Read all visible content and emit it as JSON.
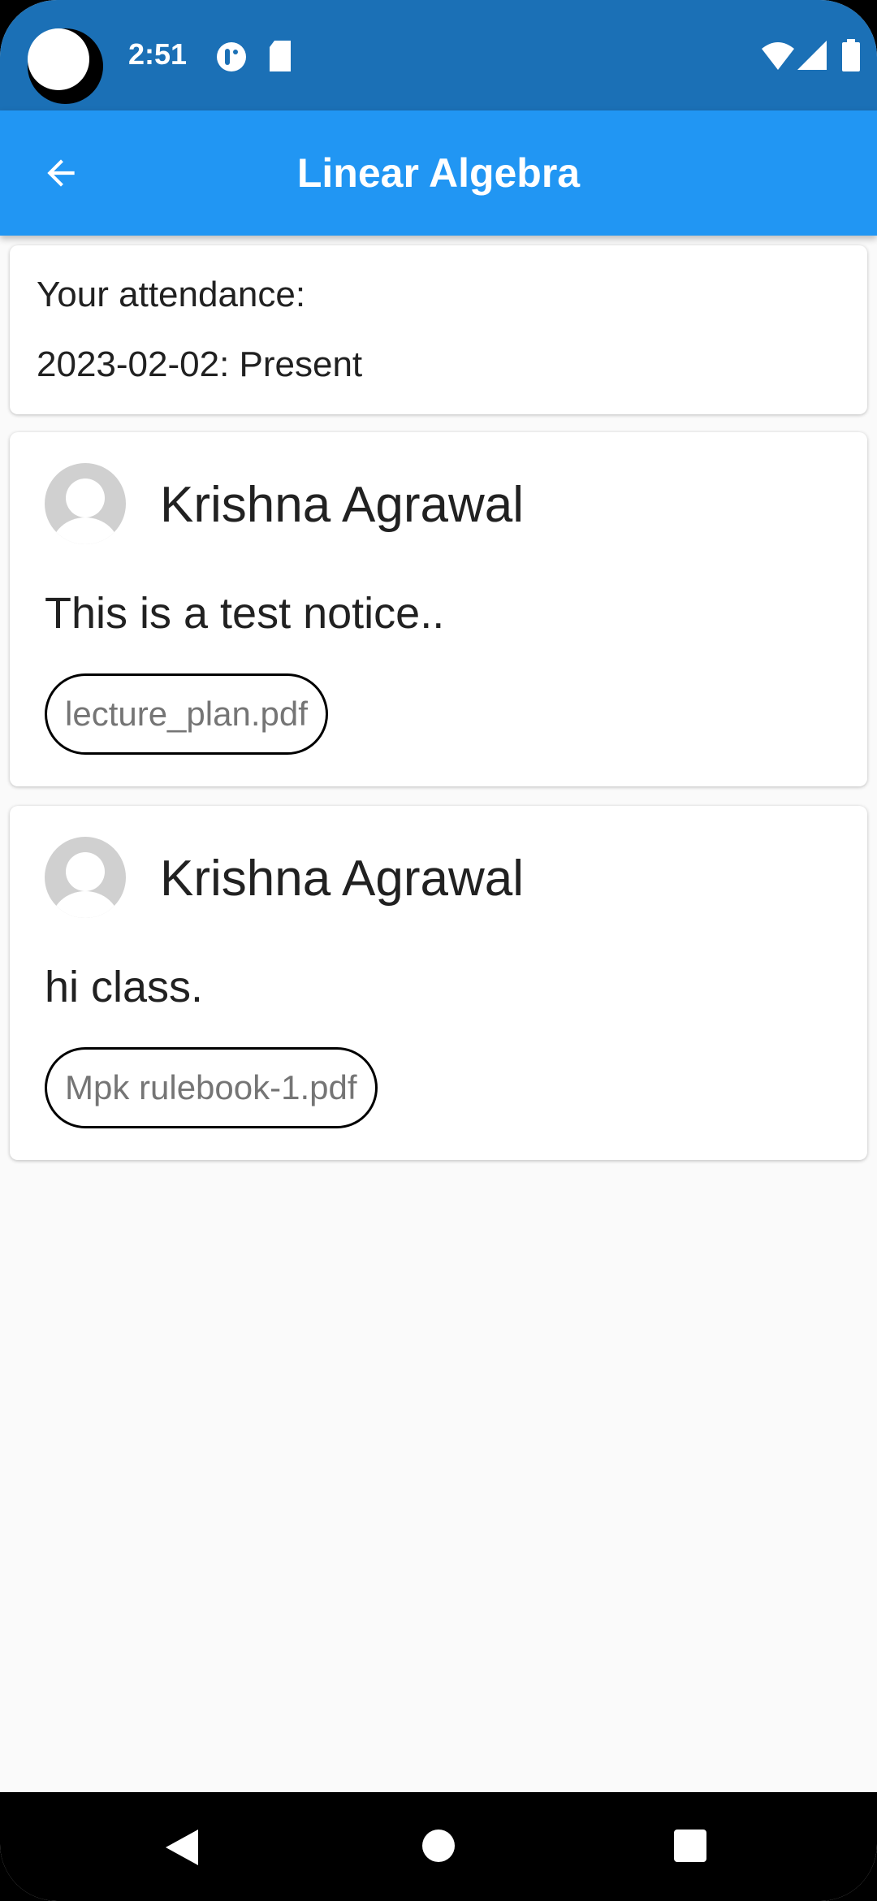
{
  "status_bar": {
    "time": "2:51"
  },
  "app_bar": {
    "title": "Linear Algebra"
  },
  "attendance": {
    "heading": "Your attendance:",
    "record": "2023-02-02: Present"
  },
  "notices": [
    {
      "author": "Krishna Agrawal",
      "message": "This is a test notice..",
      "attachment": "lecture_plan.pdf"
    },
    {
      "author": "Krishna Agrawal",
      "message": "hi class.",
      "attachment": "Mpk rulebook-1.pdf"
    }
  ],
  "colors": {
    "status": "#1b70b6",
    "primary": "#2196f3",
    "background": "#fafafa"
  }
}
